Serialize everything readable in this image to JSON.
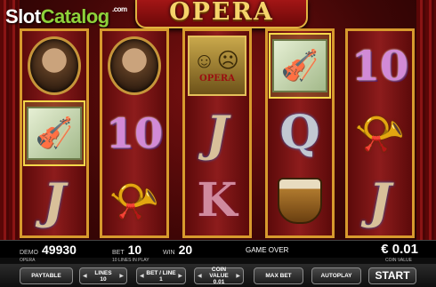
{
  "watermark": {
    "part1": "Slot",
    "part2": "Catalog",
    "suffix": ".com"
  },
  "title": "OPERA",
  "reels": [
    [
      "portrait-handel",
      "violin-sheet",
      "letter-j"
    ],
    [
      "portrait-verdi",
      "letter-10",
      "horn"
    ],
    [
      "masks",
      "letter-j",
      "letter-k"
    ],
    [
      "violin-sheet",
      "letter-q",
      "drum"
    ],
    [
      "letter-10",
      "horn",
      "letter-j"
    ]
  ],
  "symbol_text": {
    "letter-10": "10",
    "letter-j": "J",
    "letter-q": "Q",
    "letter-k": "K",
    "masks_word": "OPERA"
  },
  "info": {
    "demo_label": "DEMO",
    "demo_value": "49930",
    "bet_label": "BET",
    "bet_value": "10",
    "win_label": "WIN",
    "win_value": "20",
    "status": "GAME OVER",
    "coin_value": "€ 0.01"
  },
  "sub_info": {
    "game_name": "OPERA",
    "lines_in_play": "10 LINES IN PLAY",
    "coin_value_label": "COIN VALUE"
  },
  "buttons": {
    "paytable": "PAYTABLE",
    "lines_label": "LINES",
    "lines_value": "10",
    "bet_line_label": "BET / LINE",
    "bet_line_value": "1",
    "coin_value_label": "COIN VALUE",
    "coin_value_value": "0.01",
    "max_bet": "MAX BET",
    "autoplay": "AUTOPLAY",
    "start": "START"
  }
}
